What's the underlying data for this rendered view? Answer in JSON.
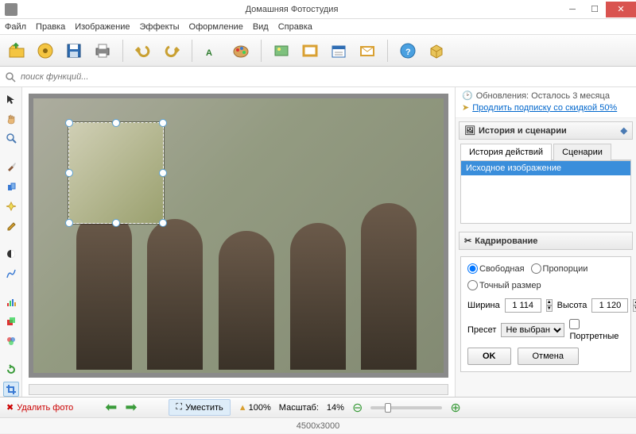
{
  "window": {
    "title": "Домашняя Фотостудия"
  },
  "menu": [
    "Файл",
    "Правка",
    "Изображение",
    "Эффекты",
    "Оформление",
    "Вид",
    "Справка"
  ],
  "search": {
    "placeholder": "поиск функций..."
  },
  "notice": {
    "line1": "Обновления: Осталось  3 месяца",
    "line2": "Продлить подписку со скидкой 50%"
  },
  "history_panel": {
    "title": "История и сценарии",
    "tab1": "История действий",
    "tab2": "Сценарии",
    "item1": "Исходное изображение"
  },
  "crop_panel": {
    "title": "Кадрирование",
    "mode_free": "Свободная",
    "mode_prop": "Пропорции",
    "mode_exact": "Точный размер",
    "width_label": "Ширина",
    "width_val": "1 114",
    "height_label": "Высота",
    "height_val": "1 120",
    "preset_label": "Пресет",
    "preset_val": "Не выбрано",
    "portrait": "Портретные",
    "ok": "OK",
    "cancel": "Отмена"
  },
  "status": {
    "delete": "Удалить фото",
    "fit": "Уместить",
    "zoom100": "100%",
    "scale_label": "Масштаб:",
    "scale_val": "14%"
  },
  "footer": {
    "dims": "4500x3000"
  }
}
